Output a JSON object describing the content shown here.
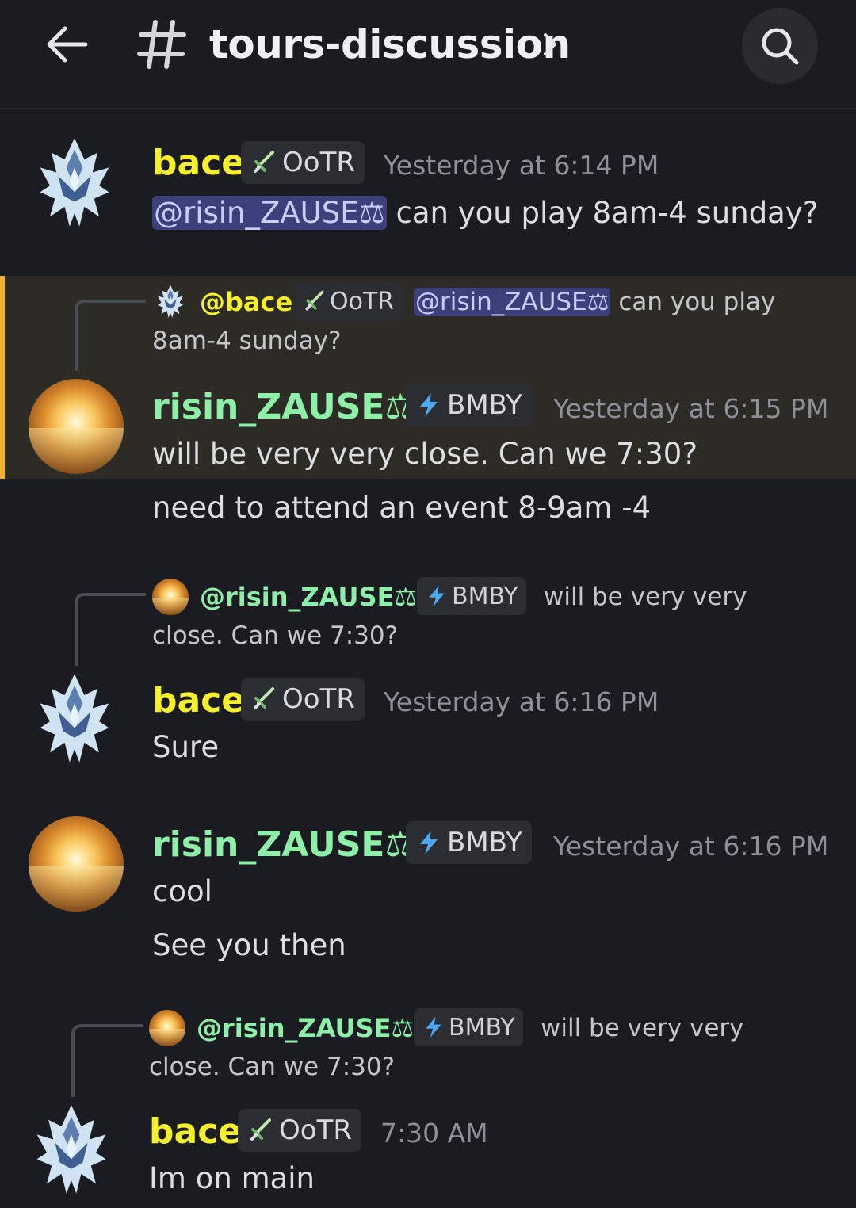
{
  "header": {
    "channel_name": "tours-discussion"
  },
  "users": {
    "bace": {
      "name": "bace",
      "reply_name": "@bace",
      "tag": "OoTR",
      "color": "#f5f02a"
    },
    "risin": {
      "name": "risin_ZAUSE⚖",
      "reply_name": "@risin_ZAUSE⚖",
      "tag": "BMBY",
      "color": "#8ef0a8"
    }
  },
  "messages": [
    {
      "author": "bace",
      "tag": "OoTR",
      "time": "Yesterday at 6:14 PM",
      "mention": "@risin_ZAUSE⚖",
      "text": " can you play 8am-4 sunday?"
    },
    {
      "reply": {
        "author": "@bace",
        "tag": "OoTR",
        "mention": "@risin_ZAUSE⚖",
        "text_line1": " can you play",
        "text_line2": "8am-4 sunday?"
      },
      "author": "risin_ZAUSE⚖",
      "tag": "BMBY",
      "time": "Yesterday at 6:15 PM",
      "text": "will be very very close. Can we 7:30?",
      "followup": "need to attend an event 8-9am -4"
    },
    {
      "reply": {
        "author": "@risin_ZAUSE⚖",
        "tag": "BMBY",
        "text_line1": "will be very very",
        "text_line2": "close. Can we 7:30?"
      },
      "author": "bace",
      "tag": "OoTR",
      "time": "Yesterday at 6:16 PM",
      "text": "Sure"
    },
    {
      "author": "risin_ZAUSE⚖",
      "tag": "BMBY",
      "time": "Yesterday at 6:16 PM",
      "text": "cool",
      "followup": "See you then"
    },
    {
      "reply": {
        "author": "@risin_ZAUSE⚖",
        "tag": "BMBY",
        "text_line1": "will be very very",
        "text_line2": "close. Can we 7:30?"
      },
      "author": "bace",
      "tag": "OoTR",
      "time": "7:30 AM",
      "text": "Im on main"
    }
  ],
  "icons": {
    "back": "arrow-left-icon",
    "channel": "hash-icon",
    "chevron": "chevron-right-icon",
    "search": "search-icon",
    "ootr_tag": "sword-icon",
    "bmby_tag": "lightning-icon"
  },
  "colors": {
    "background": "#1b1c21",
    "highlight": "#2d2b26",
    "highlight_bar": "#f0b232",
    "mention_bg": "#3c3f7a"
  }
}
